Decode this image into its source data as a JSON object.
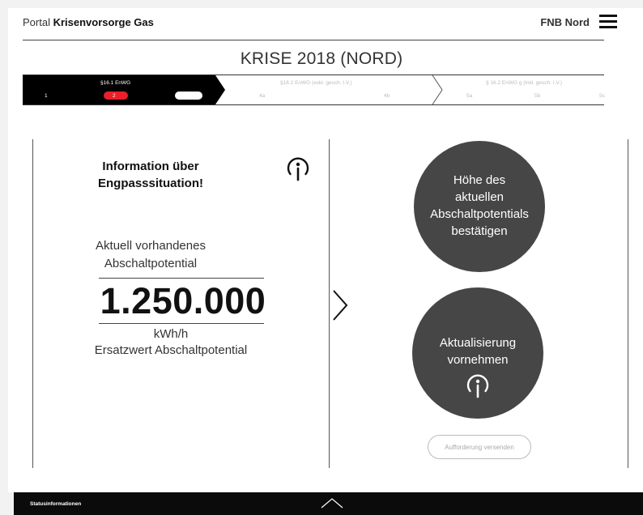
{
  "header": {
    "portal_prefix": "Portal",
    "portal_name": "Krisenvorsorge Gas",
    "organization": "FNB Nord",
    "menu_icon": "hamburger-menu-icon"
  },
  "page_title": "KRISE 2018 (NORD)",
  "progress": {
    "groups": [
      {
        "label": "§16.1 EnWG",
        "steps": [
          "1",
          "2",
          ""
        ],
        "current_step": "2"
      },
      {
        "label": "§16.2 EnWG (exkl. gesch. I.V.)",
        "steps": [
          "4a",
          "4b"
        ]
      },
      {
        "label": "§ 16.2 EnWG g (inkl. gesch. I.V.)",
        "steps": [
          "5a",
          "5b",
          "5c"
        ]
      }
    ],
    "active_color": "#000000",
    "current_color": "#e8202a"
  },
  "info_panel": {
    "title_line1": "Information über",
    "title_line2": "Engpasssituation!",
    "touch_icon": "touch-tap-icon",
    "label_line1": "Aktuell vorhandenes",
    "label_line2": "Abschaltpotential",
    "value": "1.250.000",
    "unit": "kWh/h",
    "sub_label": "Ersatzwert Abschaltpotential"
  },
  "next_icon": "chevron-right-icon",
  "actions": {
    "confirm_line1": "Höhe des",
    "confirm_line2": "aktuellen",
    "confirm_line3": "Abschaltpotentials",
    "confirm_line4": "bestätigen",
    "update_line1": "Aktualisierung",
    "update_line2": "vornehmen",
    "update_icon": "touch-tap-icon",
    "send_request": "Aufforderung versenden",
    "circle_color": "#464646"
  },
  "footer": {
    "status_label": "Statusinformationen",
    "toggle_icon": "chevron-up-icon"
  }
}
